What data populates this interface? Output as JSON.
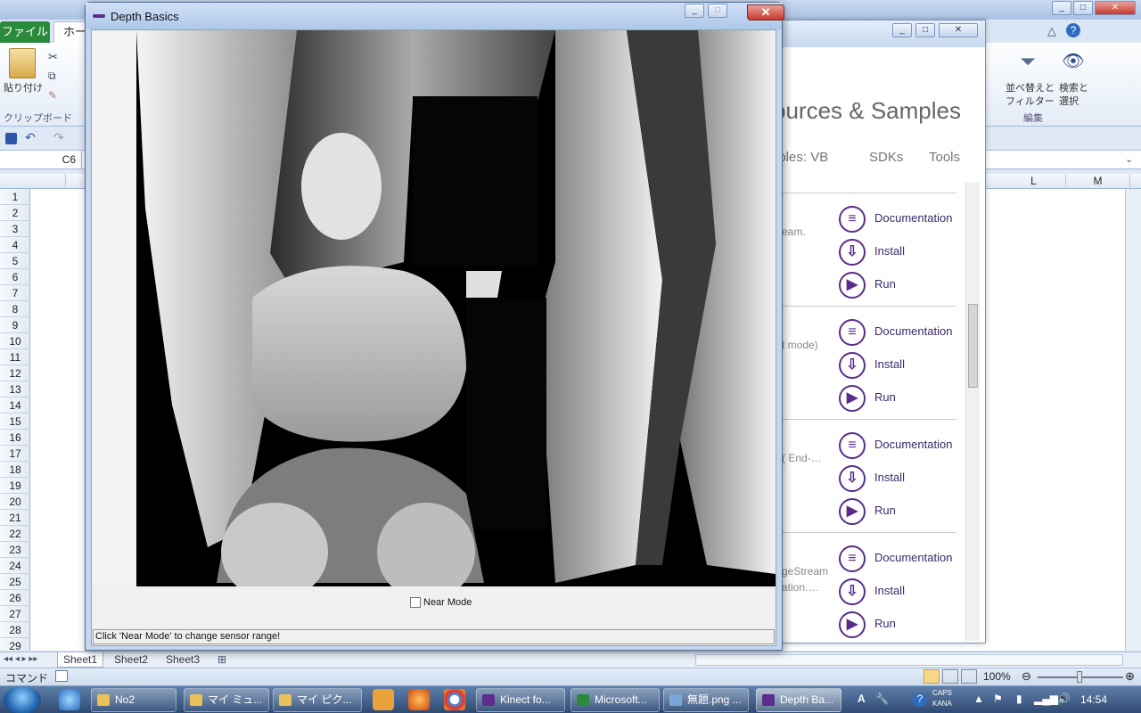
{
  "excel": {
    "file_tab": "ファイル",
    "home_tab": "ホー",
    "paste_label": "貼り付け",
    "clipboard_group": "クリップボード",
    "sort_filter_label_1": "並べ替えと",
    "sort_filter_label_2": "フィルター",
    "find_select_label_1": "検索と",
    "find_select_label_2": "選択",
    "edit_group": "編集",
    "name_box": "C6",
    "col_L": "L",
    "col_M": "M",
    "rows": [
      "1",
      "2",
      "3",
      "4",
      "5",
      "6",
      "7",
      "8",
      "9",
      "10",
      "11",
      "12",
      "13",
      "14",
      "15",
      "16",
      "17",
      "18",
      "19",
      "20",
      "21",
      "22",
      "23",
      "24",
      "25",
      "26",
      "27",
      "28",
      "29"
    ],
    "sheets": [
      "Sheet1",
      "Sheet2",
      "Sheet3"
    ],
    "status_mode": "コマンド",
    "zoom": "100%"
  },
  "kinect_browser": {
    "heading": "ources & Samples",
    "tabs": [
      "nples: VB",
      "SDKs",
      "Tools"
    ],
    "groups": [
      {
        "desc": "eam.",
        "doc": "Documentation",
        "install": "Install",
        "run": "Run"
      },
      {
        "desc": "t mode)",
        "doc": "Documentation",
        "install": "Install",
        "run": "Run"
      },
      {
        "desc": "( End-…",
        "doc": "Documentation",
        "install": "Install",
        "run": "Run"
      },
      {
        "desc": "geStream",
        "desc2": "ation.…",
        "doc": "Documentation",
        "install": "Install",
        "run": "Run"
      }
    ]
  },
  "depth_window": {
    "title": "Depth Basics",
    "near_mode_label": "Near Mode",
    "status": "Click 'Near Mode' to change sensor range!"
  },
  "taskbar": {
    "buttons": [
      "No2",
      "マイ ミュ...",
      "マイ ピク...",
      "Kinect fo...",
      "Microsoft...",
      "無題.png ...",
      "Depth Ba..."
    ],
    "ime_caps": "CAPS",
    "ime_kana": "KANA",
    "clock": "14:54"
  }
}
